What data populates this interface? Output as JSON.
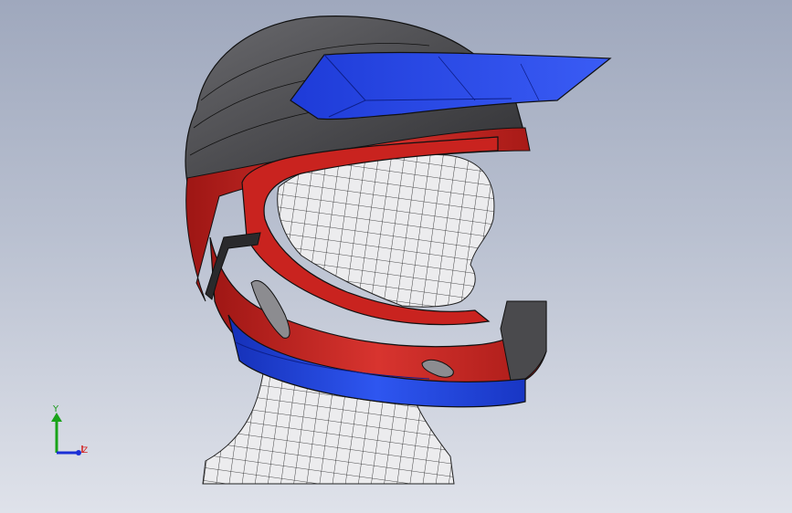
{
  "viewport": {
    "background_top": "#9fa8bd",
    "background_bottom": "#dfe2ea"
  },
  "model": {
    "name": "helmet-on-mannequin-head",
    "colors": {
      "shell_gray": "#4b4b4e",
      "shell_red": "#c0201e",
      "shell_blue": "#1f3ed1",
      "mannequin_white": "#e8e8ea",
      "mesh_lines": "#111111"
    }
  },
  "triad": {
    "y_label": "Y",
    "z_label": "Z",
    "y_color": "#19a319",
    "z_color": "#1a2fd6",
    "x_color": "#d21c1c"
  }
}
